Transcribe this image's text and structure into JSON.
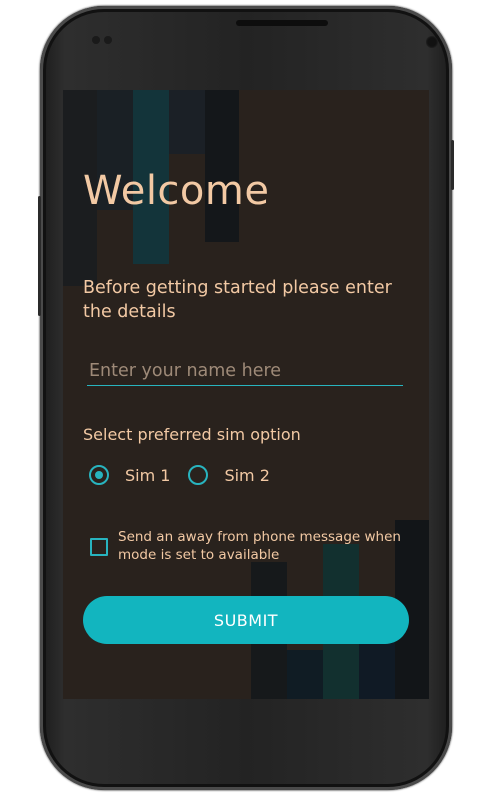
{
  "app": {
    "title": "Welcome",
    "subtitle": "Before getting started please enter the details"
  },
  "name_input": {
    "placeholder": "Enter your name here",
    "value": ""
  },
  "sim": {
    "label": "Select preferred sim option",
    "options": [
      {
        "label": "Sim 1",
        "selected": true
      },
      {
        "label": "Sim 2",
        "selected": false
      }
    ]
  },
  "away_message": {
    "label": "Send an away from phone message when mode is set to available",
    "checked": false
  },
  "submit": {
    "label": "SUBMIT"
  },
  "colors": {
    "accent": "#12b5bf",
    "text": "#f2c9a4",
    "background": "#29221d"
  }
}
